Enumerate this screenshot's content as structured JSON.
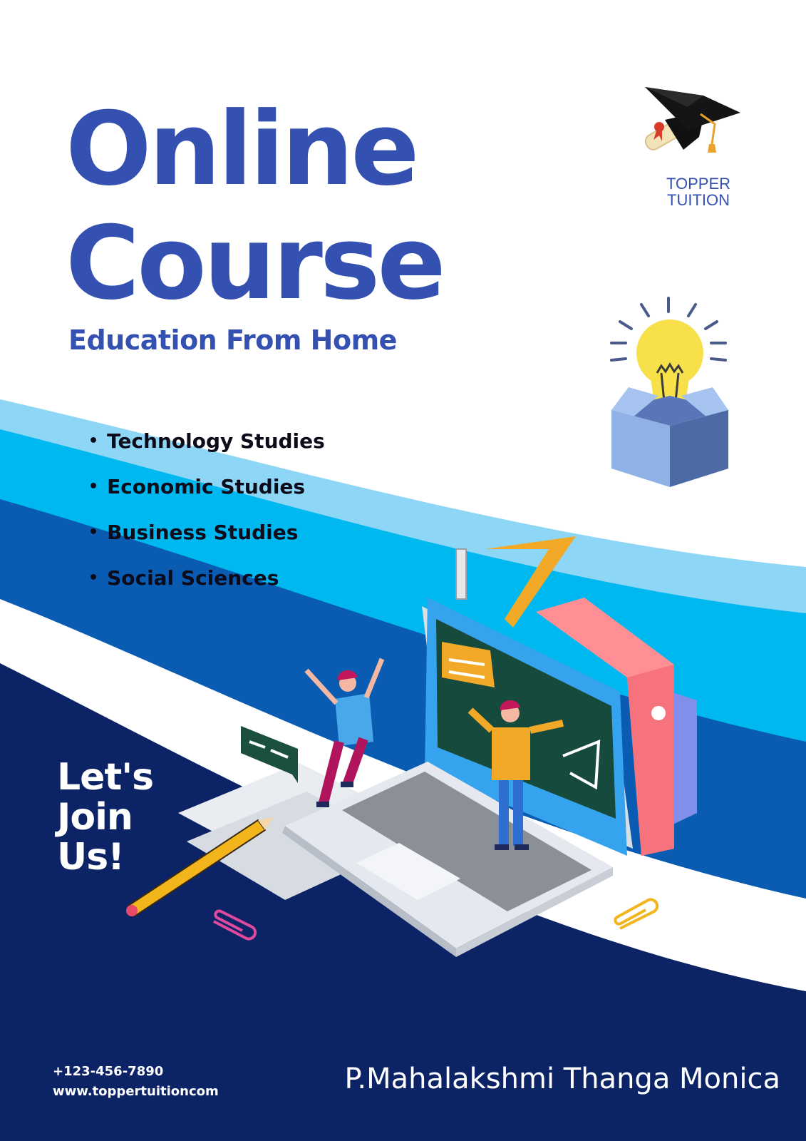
{
  "colors": {
    "primary": "#3450b1",
    "navy": "#0c2466",
    "band_light": "#8ed6f5",
    "band_cyan": "#00b8f0",
    "band_blue": "#0a5cb3",
    "text_dark": "#0b0b1a",
    "bulb": "#f7e04a",
    "box": "#8fb1e6"
  },
  "title": {
    "line1": "Online",
    "line2": "Course",
    "subtitle": "Education From Home"
  },
  "brand": {
    "line1": "TOPPER",
    "line2": "TUITION",
    "icon": "graduation-cap-diploma-icon"
  },
  "subjects": [
    "Technology Studies",
    "Economic Studies",
    "Business Studies",
    "Social Sciences"
  ],
  "cta": {
    "line1": "Let's",
    "line2": "Join",
    "line3": "Us!"
  },
  "contact": {
    "phone": "+123-456-7890",
    "website": "www.toppertuitioncom"
  },
  "author": "P.Mahalakshmi Thanga Monica",
  "icons": {
    "idea": "lightbulb-box-icon",
    "illustration": "laptop-classroom-illustration"
  }
}
